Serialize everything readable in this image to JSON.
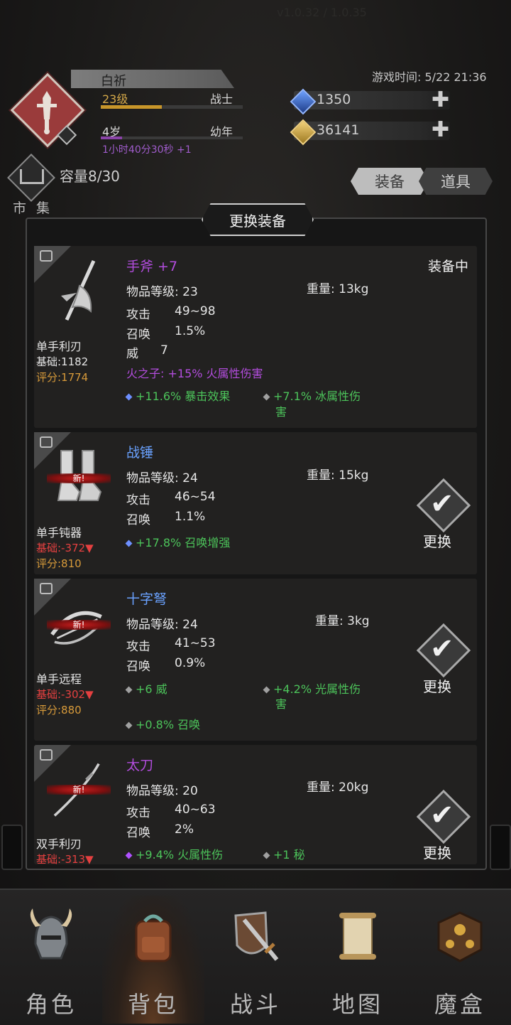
{
  "header": {
    "version": "v1.0.32 / 1.0.35",
    "game_time": "游戏时间: 5/22 21:36",
    "player_name": "白祈",
    "level": "23级",
    "class": "战士",
    "level_progress": 0.43,
    "age": "4岁",
    "life_stage": "幼年",
    "age_progress": 0.15,
    "timer": "1小时40分30秒 +1",
    "diamonds": "1350",
    "gold": "36141"
  },
  "market": {
    "label": "市 集",
    "capacity": "容量8/30"
  },
  "tabs": {
    "equip": "装备",
    "items": "道具"
  },
  "panel": {
    "title": "更换装备"
  },
  "items": [
    {
      "name": "手斧 +7",
      "level": "物品等级: 23",
      "weight": "重量:  13kg",
      "attack_label": "攻击",
      "attack": "49~98",
      "summon_label": "召唤",
      "summon": "1.5%",
      "extra_label": "威",
      "extra": "7",
      "type": "单手利刃",
      "base": "基础:1182",
      "score": "评分:1774",
      "status": "装备中",
      "special": "火之子: +15% 火属性伤害",
      "affix1": "+11.6% 暴击效果",
      "affix2a": "+7.1% 冰属性伤",
      "affix2b": "害"
    },
    {
      "name": "战锤",
      "level": "物品等级: 24",
      "weight": "重量:  15kg",
      "attack_label": "攻击",
      "attack": "46~54",
      "summon_label": "召唤",
      "summon": "1.1%",
      "type": "单手钝器",
      "base": "基础:-372▼",
      "score": "评分:810",
      "new": "新!",
      "affix1": "+17.8% 召唤增强",
      "action": "更换"
    },
    {
      "name": "十字弩",
      "level": "物品等级: 24",
      "weight": "重量:  3kg",
      "attack_label": "攻击",
      "attack": "41~53",
      "summon_label": "召唤",
      "summon": "0.9%",
      "type": "单手远程",
      "base": "基础:-302▼",
      "score": "评分:880",
      "new": "新!",
      "affix1": "+6 威",
      "affix2a": "+4.2% 光属性伤",
      "affix2b": "害",
      "affix3": "+0.8% 召唤",
      "action": "更换"
    },
    {
      "name": "太刀",
      "level": "物品等级: 20",
      "weight": "重量:  20kg",
      "attack_label": "攻击",
      "attack": "40~63",
      "summon_label": "召唤",
      "summon": "2%",
      "type": "双手利刃",
      "base": "基础:-313▼",
      "new": "新!",
      "affix1": "+9.4% 火属性伤",
      "affix2a": "+1 秘",
      "action": "更换"
    }
  ],
  "nav": [
    {
      "label": "角色",
      "icon": "helmet-icon"
    },
    {
      "label": "背包",
      "icon": "backpack-icon"
    },
    {
      "label": "战斗",
      "icon": "sword-shield-icon"
    },
    {
      "label": "地图",
      "icon": "scroll-map-icon"
    },
    {
      "label": "魔盒",
      "icon": "magic-box-icon"
    }
  ],
  "colors": {
    "accent_gold": "#d4a849",
    "affix_green": "#4cc35a",
    "affix_purple": "#b34dde",
    "negative_red": "#e54040",
    "item_name_blue": "#6aa2ff",
    "item_name_purple": "#b34dde"
  }
}
